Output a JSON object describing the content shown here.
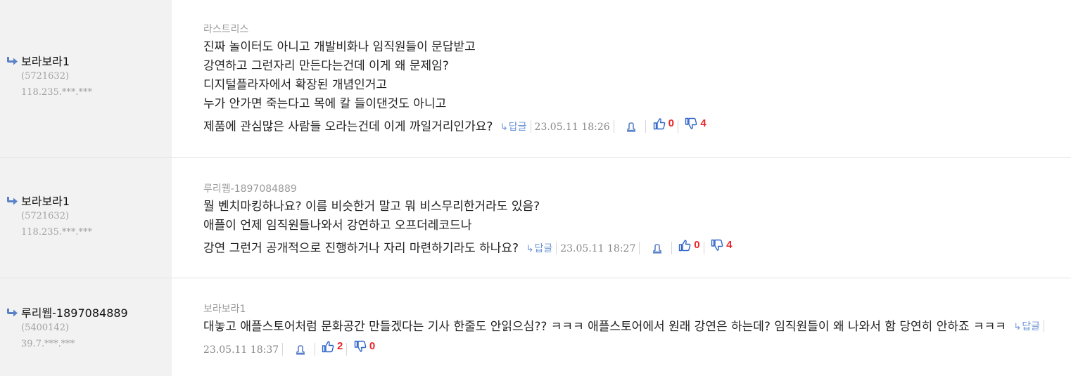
{
  "colors": {
    "accent": "#5b82c9",
    "vote_count": "#e8262a",
    "sidebar_bg": "#f2f2f2"
  },
  "comments": [
    {
      "author": "보라보라1",
      "user_id": "(5721632)",
      "ip": "118.235.***.***",
      "reply_to": "라스트리스",
      "lines": [
        "진짜 놀이터도 아니고 개발비화나 임직원들이 문답받고",
        "강연하고 그런자리 만든다는건데 이게 왜 문제임?",
        "디지털플라자에서 확장된 개념인거고",
        "누가 안가면 죽는다고 목에 칼 들이댄것도 아니고",
        "제품에 관심많은 사람들 오라는건데 이게 까일거리인가요?"
      ],
      "reply_label": "답글",
      "date": "23.05.11 18:26",
      "likes": "0",
      "dislikes": "4"
    },
    {
      "author": "보라보라1",
      "user_id": "(5721632)",
      "ip": "118.235.***.***",
      "reply_to": "루리웹-1897084889",
      "lines": [
        "뭘 벤치마킹하나요? 이름 비슷한거 말고 뭐 비스무리한거라도 있음?",
        "애플이 언제 임직원들나와서 강연하고 오프더레코드나",
        "강연 그런거 공개적으로 진행하거나 자리 마련하기라도 하나요?"
      ],
      "reply_label": "답글",
      "date": "23.05.11 18:27",
      "likes": "0",
      "dislikes": "4"
    },
    {
      "author": "루리웹-1897084889",
      "user_id": "(5400142)",
      "ip": "39.7.***.***",
      "reply_to": "보라보라1",
      "lines": [
        "대놓고 애플스토어처럼 문화공간 만들겠다는 기사 한줄도 안읽으심?? ㅋㅋㅋ 애플스토어에서 원래 강연은 하는데? 임직원들이 왜 나와서 함 당연히 안하죠 ㅋㅋㅋ"
      ],
      "reply_label": "답글",
      "date": "23.05.11 18:37",
      "likes": "2",
      "dislikes": "0"
    }
  ],
  "icons": {
    "reply_arrow": "reply-arrow-icon",
    "report": "bell-icon",
    "like": "thumbs-up-icon",
    "dislike": "thumbs-down-icon"
  }
}
